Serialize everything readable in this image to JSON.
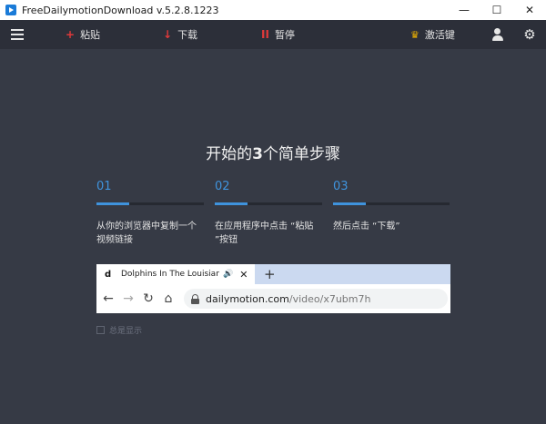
{
  "window": {
    "title": "FreeDailymotionDownload  v.5.2.8.1223",
    "minimize": "—",
    "maximize": "☐",
    "close": "✕"
  },
  "toolbar": {
    "paste": {
      "symbol": "+",
      "label": "粘贴"
    },
    "download": {
      "symbol": "↓",
      "label": "下载"
    },
    "pause": {
      "symbol": "II",
      "label": "暂停"
    },
    "activate": {
      "label": "激活键"
    },
    "icons": [
      "menu-icon",
      "crown-icon",
      "user-icon",
      "gear-icon"
    ],
    "accent": "#e0393a"
  },
  "main": {
    "heading_pre": "开始的",
    "heading_num": "3",
    "heading_post": "个简单步骤",
    "accent": "#3f93dd",
    "steps": [
      {
        "num": "01",
        "text": "从你的浏览器中复制一个\n视频链接"
      },
      {
        "num": "02",
        "text": "在应用程序中点击 “粘贴\n”按钮"
      },
      {
        "num": "03",
        "text": "然后点击 “下载”"
      }
    ]
  },
  "browser": {
    "tab_favicon": "d",
    "tab_title": "Dolphins In The Louisiana Bayou",
    "url_host": "dailymotion.com",
    "url_path": "/video/x7ubm7h",
    "new_tab": "+"
  },
  "checkbox": {
    "label": "总是显示",
    "checked": false
  }
}
